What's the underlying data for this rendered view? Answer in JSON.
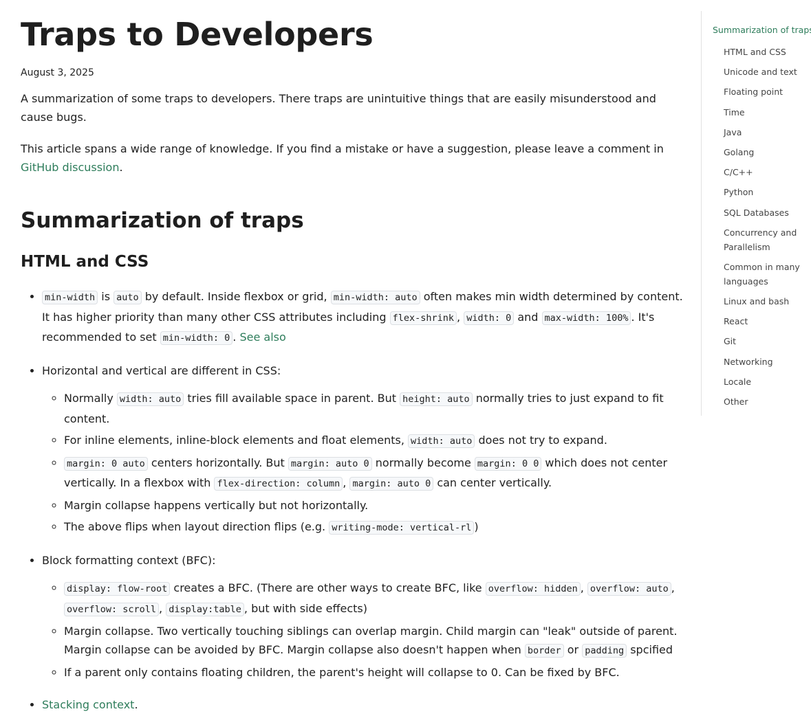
{
  "article": {
    "title": "Traps to Developers",
    "date": "August 3, 2025",
    "intro1": "A summarization of some traps to developers. There traps are unintuitive things that are easily misunderstood and cause bugs.",
    "intro2_text": "This article spans a wide range of knowledge. If you find a mistake or have a suggestion, please leave a comment in ",
    "intro2_link": "GitHub discussion",
    "intro2_end": "."
  },
  "section": {
    "heading": "Summarization of traps",
    "subheading": "HTML and CSS"
  },
  "items": {
    "b1": {
      "c1": "min-width",
      "t1": " is ",
      "c2": "auto",
      "t2": " by default. Inside flexbox or grid, ",
      "c3": "min-width: auto",
      "t3": " often makes min width determined by content. It has higher priority than many other CSS attributes including ",
      "c4": "flex-shrink",
      "t4": ", ",
      "c5": "width: 0",
      "t5": " and ",
      "c6": "max-width: 100%",
      "t6": ". It's recommended to set ",
      "c7": "min-width: 0",
      "t7": ". ",
      "link": "See also"
    },
    "b2": {
      "text": "Horizontal and vertical are different in CSS:",
      "s1": {
        "t1": "Normally ",
        "c1": "width: auto",
        "t2": " tries fill available space in parent. But ",
        "c2": "height: auto",
        "t3": " normally tries to just expand to fit content."
      },
      "s2": {
        "t1": "For inline elements, inline-block elements and float elements, ",
        "c1": "width: auto",
        "t2": " does not try to expand."
      },
      "s3": {
        "c1": "margin: 0 auto",
        "t1": " centers horizontally. But ",
        "c2": "margin: auto 0",
        "t2": " normally become ",
        "c3": "margin: 0 0",
        "t3": " which does not center vertically. In a flexbox with ",
        "c4": "flex-direction: column",
        "t4": ", ",
        "c5": "margin: auto 0",
        "t5": " can center vertically."
      },
      "s4": {
        "text": "Margin collapse happens vertically but not horizontally."
      },
      "s5": {
        "t1": "The above flips when layout direction flips (e.g. ",
        "c1": "writing-mode: vertical-rl",
        "t2": ")"
      }
    },
    "b3": {
      "text": "Block formatting context (BFC):",
      "s1": {
        "c1": "display: flow-root",
        "t1": " creates a BFC. (There are other ways to create BFC, like ",
        "c2": "overflow: hidden",
        "t2": ", ",
        "c3": "overflow: auto",
        "t3": ", ",
        "c4": "overflow: scroll",
        "t4": ", ",
        "c5": "display:table",
        "t5": ", but with side effects)"
      },
      "s2": {
        "t1": "Margin collapse. Two vertically touching siblings can overlap margin. Child margin can \"leak\" outside of parent. Margin collapse can be avoided by BFC. Margin collapse also doesn't happen when ",
        "c1": "border",
        "t2": " or ",
        "c2": "padding",
        "t3": " spcified"
      },
      "s3": {
        "text": "If a parent only contains floating children, the parent's height will collapse to 0. Can be fixed by BFC."
      }
    },
    "b4": {
      "link": "Stacking context",
      "t1": "."
    }
  },
  "toc": {
    "active": "Summarization of traps",
    "items": [
      "HTML and CSS",
      "Unicode and text",
      "Floating point",
      "Time",
      "Java",
      "Golang",
      "C/C++",
      "Python",
      "SQL Databases",
      "Concurrency and Parallelism",
      "Common in many languages",
      "Linux and bash",
      "React",
      "Git",
      "Networking",
      "Locale",
      "Other"
    ]
  },
  "colors": {
    "link": "#2e7d5b",
    "text": "#222222",
    "code_bg": "#f6f8fa"
  }
}
